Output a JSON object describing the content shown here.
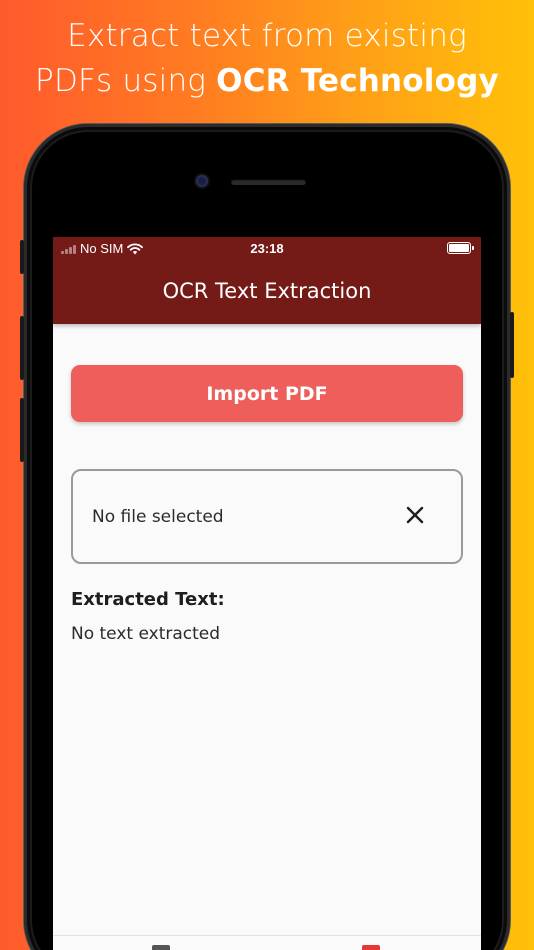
{
  "headline": {
    "line1": "Extract text from existing",
    "line2_regular": "PDFs using ",
    "line2_bold": "OCR Technology"
  },
  "status_bar": {
    "carrier": "No SIM",
    "time": "23:18"
  },
  "app_bar": {
    "title": "OCR Text Extraction"
  },
  "main": {
    "import_button_label": "Import PDF",
    "file_status": "No file selected",
    "section_title": "Extracted Text:",
    "extracted_text": "No text extracted"
  },
  "colors": {
    "app_bar": "#741b18",
    "import_button": "#ee5f5b",
    "active_tab": "#e53935"
  }
}
